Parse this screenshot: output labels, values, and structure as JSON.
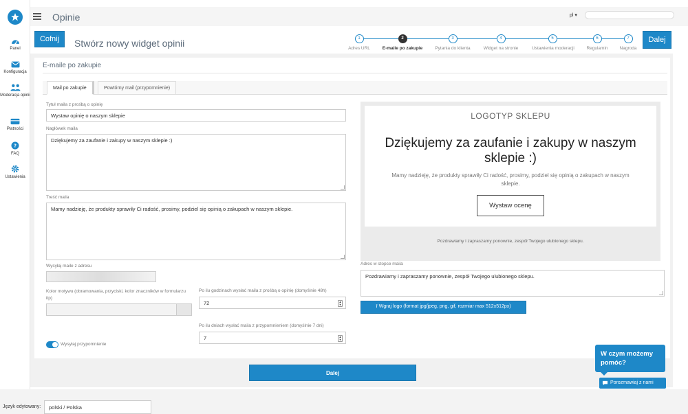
{
  "topbar": {
    "title": "Opinie",
    "lang": "pl ▾"
  },
  "sidebar": {
    "items": [
      {
        "label": "Panel",
        "icon": "dashboard-icon"
      },
      {
        "label": "Konfiguracja",
        "icon": "envelope-icon"
      },
      {
        "label": "Moderacja opinii",
        "icon": "users-icon"
      },
      {
        "label": "Płatności",
        "icon": "card-icon"
      },
      {
        "label": "FAQ",
        "icon": "question-icon"
      },
      {
        "label": "Ustawienia",
        "icon": "gear-icon"
      }
    ]
  },
  "header": {
    "back_label": "Cofnij",
    "title": "Stwórz nowy widget opinii",
    "next_label": "Dalej"
  },
  "stepper": {
    "steps": [
      {
        "num": "1",
        "label": "Adres URL"
      },
      {
        "num": "2",
        "label": "E-maile po zakupie"
      },
      {
        "num": "3",
        "label": "Pytania do klienta"
      },
      {
        "num": "4",
        "label": "Widget na stronie"
      },
      {
        "num": "5",
        "label": "Ustawienia moderacji"
      },
      {
        "num": "6",
        "label": "Regulamin"
      },
      {
        "num": "7",
        "label": "Nagroda"
      }
    ],
    "active_index": 1
  },
  "section": {
    "title": "E-maile po zakupie"
  },
  "tabs": [
    {
      "label": "Mail po zakupie"
    },
    {
      "label": "Powtórny mail (przypomnienie)"
    }
  ],
  "form": {
    "subject_label": "Tytuł maila z prośbą o opinię",
    "subject_value": "Wystaw opinię o naszym sklepie",
    "heading_label": "Nagłówek maila",
    "heading_value": "Dziękujemy za zaufanie i zakupy w naszym sklepie :)",
    "body_label": "Treść maila",
    "body_value": "Mamy nadzieję, że produkty sprawiły Ci radość, prosimy, podziel się opinią o zakupach w naszym sklepie.",
    "sender_label": "Wysyłaj maile z adresu",
    "color_label": "Kolor motywu (obramowania, przyciski, kolor znaczników w formularzu itp)",
    "hours_label": "Po ilu godzinach wysłać maila z prośbą o opinię (domyślnie 48h)",
    "hours_value": "72",
    "days_label": "Po ilu dniach wysłać maila z przypomnieniem (domyślnie 7 dni)",
    "days_value": "7",
    "reminder_label": "Wysyłaj przypomnienie",
    "footer_addr_label": "Adres w stopce maila",
    "footer_addr_value": "Pozdrawiamy i zapraszamy ponownie, zespół Twojego ulubionego sklepu.",
    "upload_label": "Wgraj logo (format jpg/jpeg, png, gif, rozmiar max 512x512px)"
  },
  "preview": {
    "logo": "LOGOTYP SKLEPU",
    "heading": "Dziękujemy za zaufanie i zakupy w naszym sklepie :)",
    "text": "Mamy nadzieję, że produkty sprawiły Ci radość, prosimy, podziel się opinią o zakupach w naszym sklepie.",
    "button": "Wystaw ocenę",
    "footer": "Pozdrawiamy i zapraszamy ponownie, zespół Twojego ulubionego sklepu."
  },
  "next_bottom_label": "Dalej",
  "chat": {
    "bubble": "W czym możemy pomóc?",
    "button": "Porozmawiaj z nami"
  },
  "bottom": {
    "lang_label": "Język edytowany:",
    "lang_value": "polski / Polska"
  },
  "colors": {
    "accent": "#1e88c8"
  }
}
